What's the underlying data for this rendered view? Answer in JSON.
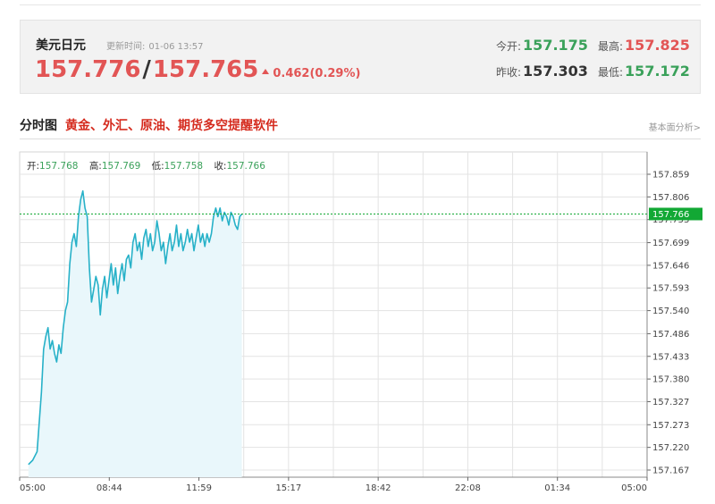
{
  "quote": {
    "name": "美元日元",
    "update_label": "更新时间:",
    "update_time": "01-06 13:57",
    "bid": "157.776",
    "ask": "157.765",
    "change": "0.462(0.29%)",
    "open_label": "今开:",
    "open": "157.175",
    "high_label": "最高:",
    "high": "157.825",
    "prev_close_label": "昨收:",
    "prev_close": "157.303",
    "low_label": "最低:",
    "low": "157.172"
  },
  "section": {
    "title": "分时图",
    "promo_link": "黄金、外汇、原油、期货多空提醒软件",
    "right_link": "基本面分析>"
  },
  "ohlc": {
    "open_label": "开:",
    "open": "157.768",
    "high_label": "高:",
    "high": "157.769",
    "low_label": "低:",
    "low": "157.758",
    "close_label": "收:",
    "close": "157.766"
  },
  "colors": {
    "line": "#27b1c8",
    "area": "#e9f7fb",
    "current_badge": "#12a834",
    "grid": "#e3e3e3"
  },
  "chart_data": {
    "type": "area",
    "y_ticks": [
      "157.859",
      "157.806",
      "157.753",
      "157.699",
      "157.646",
      "157.593",
      "157.540",
      "157.486",
      "157.433",
      "157.380",
      "157.327",
      "157.273",
      "157.220",
      "157.167"
    ],
    "ylim": [
      157.167,
      157.859
    ],
    "x_ticks": [
      "05:00",
      "08:44",
      "11:59",
      "15:17",
      "18:42",
      "22:08",
      "01:34",
      "05:00"
    ],
    "x_minutes_range": [
      0,
      1440
    ],
    "current_price": 157.766,
    "current_label": "157.766",
    "times": [
      20,
      30,
      40,
      50,
      55,
      60,
      65,
      70,
      75,
      80,
      85,
      90,
      95,
      100,
      105,
      110,
      115,
      120,
      125,
      130,
      135,
      140,
      145,
      150,
      155,
      160,
      165,
      170,
      175,
      180,
      185,
      190,
      195,
      200,
      205,
      210,
      215,
      220,
      225,
      230,
      235,
      240,
      245,
      250,
      255,
      260,
      265,
      270,
      275,
      280,
      285,
      290,
      295,
      300,
      305,
      310,
      315,
      320,
      325,
      330,
      335,
      340,
      345,
      350,
      355,
      360,
      365,
      370,
      375,
      380,
      385,
      390,
      395,
      400,
      405,
      410,
      415,
      420,
      425,
      430,
      435,
      440,
      445,
      450,
      455,
      460,
      465,
      470,
      475,
      480,
      485,
      490,
      495,
      500,
      505,
      510
    ],
    "values": [
      157.18,
      157.19,
      157.21,
      157.35,
      157.45,
      157.48,
      157.5,
      157.45,
      157.47,
      157.44,
      157.42,
      157.46,
      157.44,
      157.5,
      157.54,
      157.56,
      157.65,
      157.7,
      157.72,
      157.69,
      157.76,
      157.8,
      157.82,
      157.78,
      157.76,
      157.64,
      157.56,
      157.59,
      157.62,
      157.6,
      157.53,
      157.59,
      157.62,
      157.57,
      157.61,
      157.65,
      157.6,
      157.64,
      157.58,
      157.62,
      157.65,
      157.61,
      157.66,
      157.67,
      157.64,
      157.7,
      157.72,
      157.68,
      157.7,
      157.66,
      157.71,
      157.73,
      157.69,
      157.72,
      157.68,
      157.7,
      157.75,
      157.72,
      157.68,
      157.7,
      157.65,
      157.69,
      157.72,
      157.68,
      157.7,
      157.74,
      157.69,
      157.72,
      157.68,
      157.7,
      157.73,
      157.7,
      157.72,
      157.68,
      157.71,
      157.74,
      157.7,
      157.72,
      157.69,
      157.72,
      157.7,
      157.72,
      157.76,
      157.78,
      157.76,
      157.78,
      157.75,
      157.77,
      157.76,
      157.74,
      157.77,
      157.76,
      157.74,
      157.73,
      157.76,
      157.766
    ]
  }
}
